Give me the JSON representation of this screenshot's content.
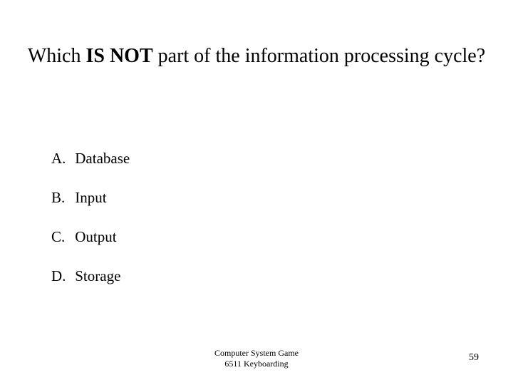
{
  "title": {
    "pre": "Which ",
    "emph": "IS NOT",
    "post": " part of the information processing cycle?"
  },
  "options": {
    "a": {
      "letter": "A.",
      "text": "Database"
    },
    "b": {
      "letter": "B.",
      "text": "Input"
    },
    "c": {
      "letter": "C.",
      "text": "Output"
    },
    "d": {
      "letter": "D.",
      "text": "Storage"
    }
  },
  "footer": {
    "line1": "Computer System Game",
    "line2": "6511  Keyboarding",
    "pageNumber": "59"
  }
}
